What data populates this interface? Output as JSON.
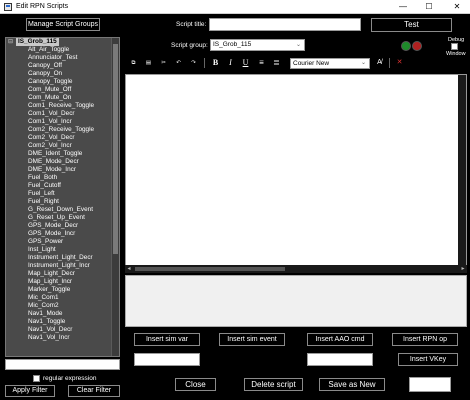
{
  "window": {
    "title": "Edit RPN Scripts",
    "minimize": "—",
    "maximize": "☐",
    "close": "✕"
  },
  "left": {
    "manage_button": "Manage Script Groups",
    "tree_root": "IS_Grob_115",
    "tree_items": [
      "Alt_Air_Toggle",
      "Annunciator_Test",
      "Canopy_Off",
      "Canopy_On",
      "Canopy_Toggle",
      "Com_Mute_Off",
      "Com_Mute_On",
      "Com1_Receive_Toggle",
      "Com1_Vol_Decr",
      "Com1_Vol_Incr",
      "Com2_Receive_Toggle",
      "Com2_Vol_Decr",
      "Com2_Vol_Incr",
      "DME_Ident_Toggle",
      "DME_Mode_Decr",
      "DME_Mode_Incr",
      "Fuel_Both",
      "Fuel_Cutoff",
      "Fuel_Left",
      "Fuel_Right",
      "G_Reset_Down_Event",
      "G_Reset_Up_Event",
      "GPS_Mode_Decr",
      "GPS_Mode_Incr",
      "GPS_Power",
      "Inst_Light",
      "Instrument_Light_Decr",
      "Instrument_Light_Incr",
      "Map_Light_Decr",
      "Map_Light_Incr",
      "Marker_Toggle",
      "Mic_Com1",
      "Mic_Com2",
      "Nav1_Mode",
      "Nav1_Toggle",
      "Nav1_Vol_Decr",
      "Nav1_Vol_Incr"
    ],
    "filter_value": "",
    "regex_label": "regular expression",
    "regex_checked": false,
    "apply_filter": "Apply Filter",
    "clear_filter": "Clear Filter"
  },
  "header": {
    "script_title_label": "Script title:",
    "script_title_value": "",
    "test_button": "Test",
    "script_group_label": "Script group:",
    "script_group_value": "IS_Grob_115",
    "debug_label": "Debug",
    "window_label": "Window",
    "debug_checked": false,
    "led_colors": [
      "#1e8a2a",
      "#b02020"
    ]
  },
  "toolbar": {
    "font_value": "Courier New",
    "buttons": [
      {
        "name": "copy-icon",
        "glyph": "⧉"
      },
      {
        "name": "paste-icon",
        "glyph": "▤"
      },
      {
        "name": "cut-icon",
        "glyph": "✂"
      },
      {
        "name": "undo-icon",
        "glyph": "↶"
      },
      {
        "name": "redo-icon",
        "glyph": "↷"
      }
    ],
    "format": [
      {
        "name": "bold-button",
        "glyph": "B"
      },
      {
        "name": "italic-button",
        "glyph": "I"
      },
      {
        "name": "underline-button",
        "glyph": "U"
      }
    ],
    "align_left_glyph": "≡",
    "align_right_glyph": "≣",
    "clear_format_glyph": "A̸",
    "stop_glyph": "✕"
  },
  "actions": {
    "insert_sim_var": "Insert sim var",
    "insert_sim_event": "Insert sim event",
    "insert_aao_cmd": "Insert AAO cmd",
    "insert_rpn_op": "Insert RPN op",
    "insert_vkey": "Insert VKey",
    "field1": "",
    "field2": "",
    "field3": ""
  },
  "footer": {
    "close": "Close",
    "delete_script": "Delete script",
    "save_as_new": "Save as New",
    "save_blank": ""
  }
}
